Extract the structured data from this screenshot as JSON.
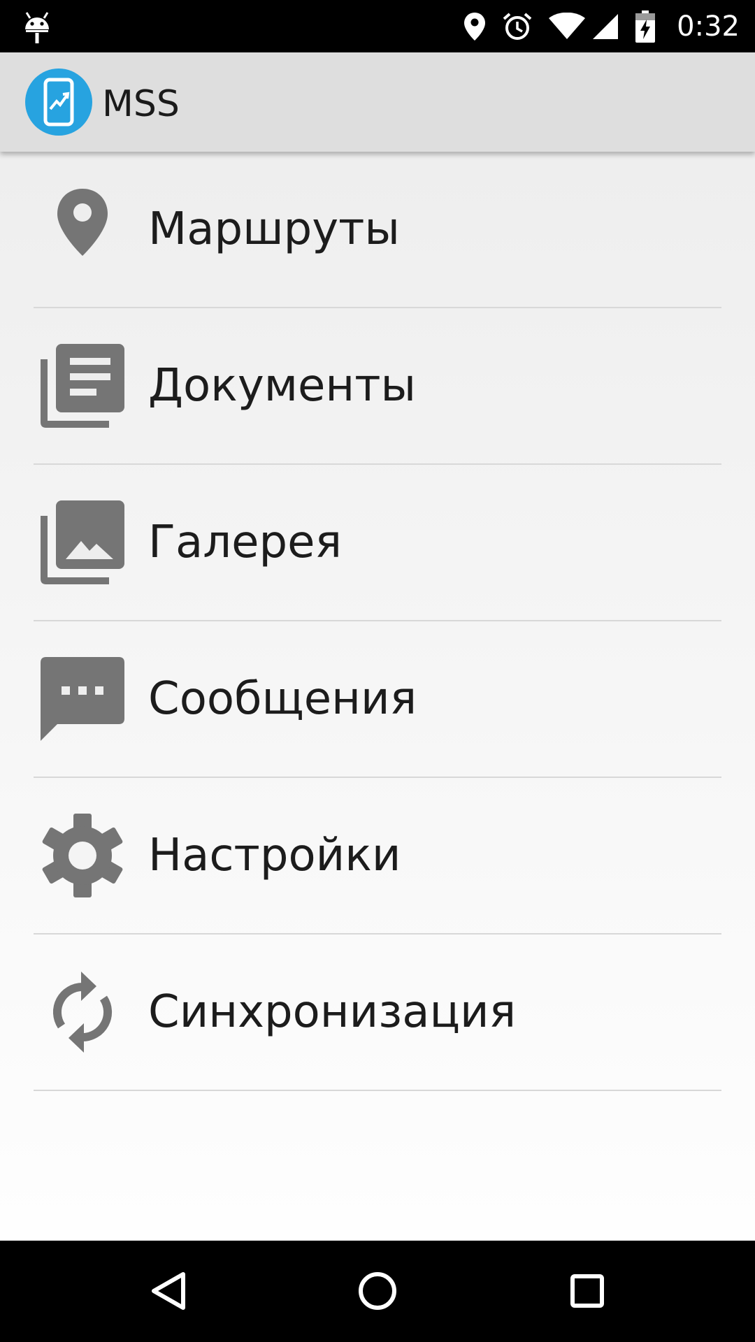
{
  "status_bar": {
    "time": "0:32",
    "icons": [
      "android-debug-icon",
      "location-icon",
      "alarm-icon",
      "wifi-icon",
      "signal-icon",
      "battery-charging-icon"
    ]
  },
  "app_bar": {
    "title": "MSS",
    "logo_icon": "app-logo-icon",
    "logo_color": "#27a3e0"
  },
  "menu": {
    "items": [
      {
        "label": "Маршруты",
        "icon": "map-pin-icon"
      },
      {
        "label": "Документы",
        "icon": "documents-icon"
      },
      {
        "label": "Галерея",
        "icon": "gallery-icon"
      },
      {
        "label": "Сообщения",
        "icon": "message-icon"
      },
      {
        "label": "Настройки",
        "icon": "settings-gear-icon"
      },
      {
        "label": "Синхронизация",
        "icon": "sync-icon"
      }
    ],
    "icon_color": "#757575"
  },
  "nav_bar": {
    "buttons": [
      "back-icon",
      "home-icon",
      "recents-icon"
    ]
  }
}
